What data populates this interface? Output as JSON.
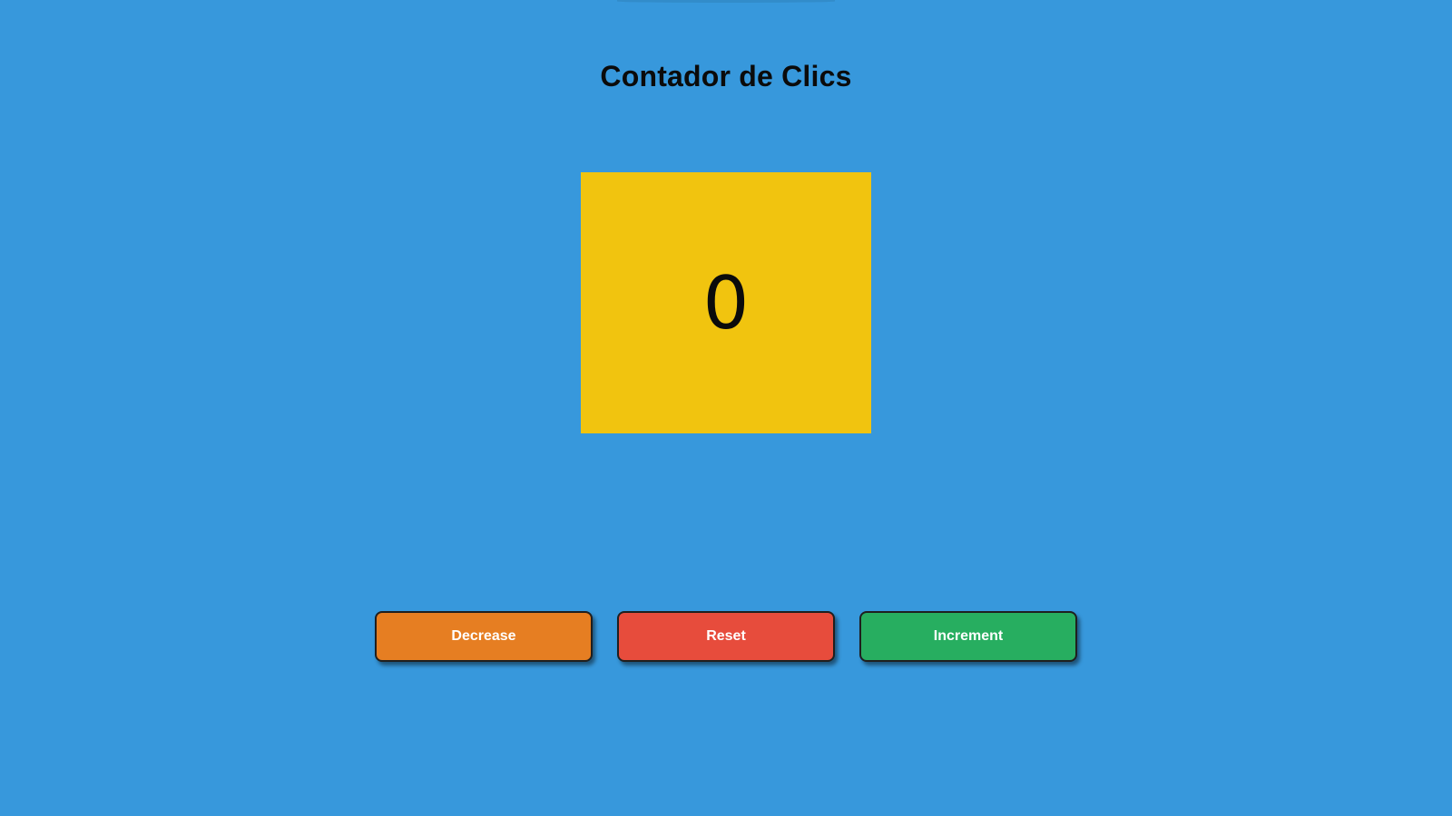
{
  "header": {
    "title": "Contador de Clics"
  },
  "counter": {
    "value": "0"
  },
  "controls": {
    "decrease_label": "Decrease",
    "reset_label": "Reset",
    "increment_label": "Increment"
  },
  "colors": {
    "background": "#3798dc",
    "counter_box": "#f1c40f",
    "decrease": "#e67e22",
    "reset": "#e74c3c",
    "increment": "#27ae60"
  }
}
